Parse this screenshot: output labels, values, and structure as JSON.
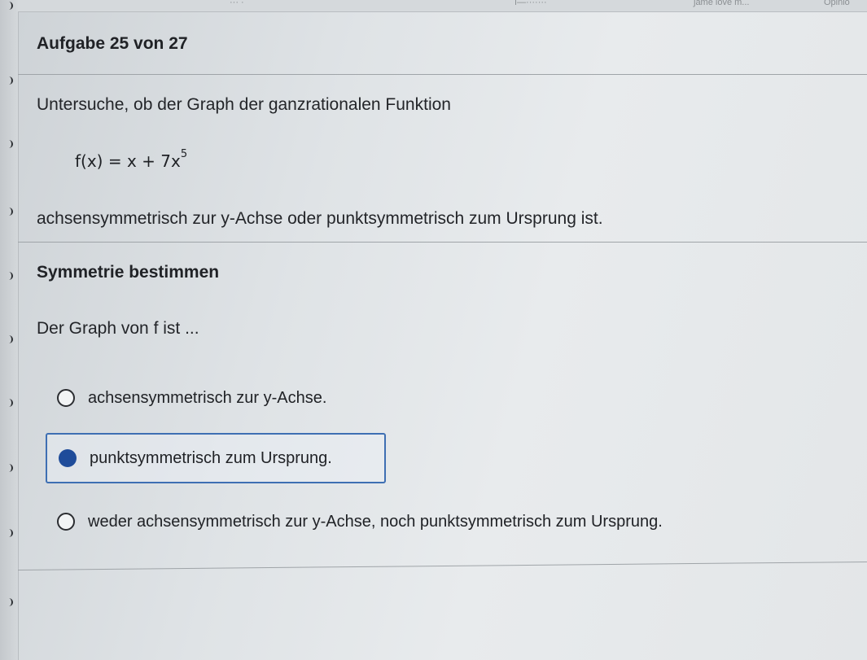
{
  "topbar": {
    "fragment_left": "··· ·",
    "fragment_mid": "ı—·······",
    "fragment_right": "ʃame love m...",
    "fragment_far": "Opinio"
  },
  "header": {
    "task_counter": "Aufgabe 25 von 27"
  },
  "question": {
    "intro": "Untersuche, ob der Graph der ganzrationalen Funktion",
    "formula_base": "f(x) = x + 7x",
    "formula_exponent": "5",
    "prompt": "achsensymmetrisch zur y-Achse oder punktsymmetrisch zum Ursprung ist."
  },
  "section": {
    "title": "Symmetrie bestimmen",
    "lead": "Der Graph von f ist ..."
  },
  "options": [
    {
      "label": "achsensymmetrisch zur y-Achse.",
      "selected": false
    },
    {
      "label": "punktsymmetrisch zum Ursprung.",
      "selected": true
    },
    {
      "label": "weder achsensymmetrisch zur y-Achse, noch punktsymmetrisch zum Ursprung.",
      "selected": false
    }
  ],
  "colors": {
    "selected_border": "#3e6fb3",
    "selected_radio": "#1f4c9a"
  }
}
